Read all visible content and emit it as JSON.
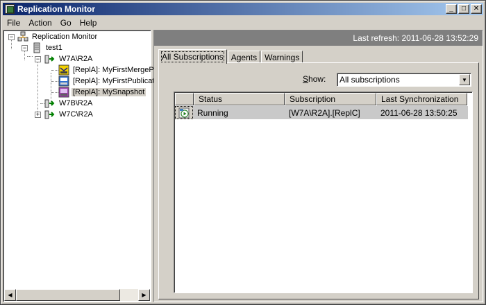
{
  "window": {
    "title": "Replication Monitor"
  },
  "menu": {
    "items": [
      "File",
      "Action",
      "Go",
      "Help"
    ]
  },
  "tree": {
    "root": "Replication Monitor",
    "server": "test1",
    "publishers": [
      {
        "name": "W7A\\R2A",
        "publications": [
          {
            "label": "[ReplA]: MyFirstMergeP"
          },
          {
            "label": "[ReplA]: MyFirstPublicat"
          },
          {
            "label": "[ReplA]: MySnapshot"
          }
        ]
      },
      {
        "name": "W7B\\R2A"
      },
      {
        "name": "W7C\\R2A"
      }
    ]
  },
  "refresh": {
    "text": "Last refresh: 2011-06-28 13:52:29"
  },
  "tabs": [
    "All Subscriptions",
    "Agents",
    "Warnings"
  ],
  "filter": {
    "label_prefix": "S",
    "label_rest": "how:",
    "selected": "All subscriptions"
  },
  "grid": {
    "columns": [
      "Status",
      "Subscription",
      "Last Synchronization"
    ],
    "rows": [
      {
        "status": "Running",
        "subscription": "[W7A\\R2A].[ReplC]",
        "last_sync": "2011-06-28 13:50:25"
      }
    ]
  }
}
